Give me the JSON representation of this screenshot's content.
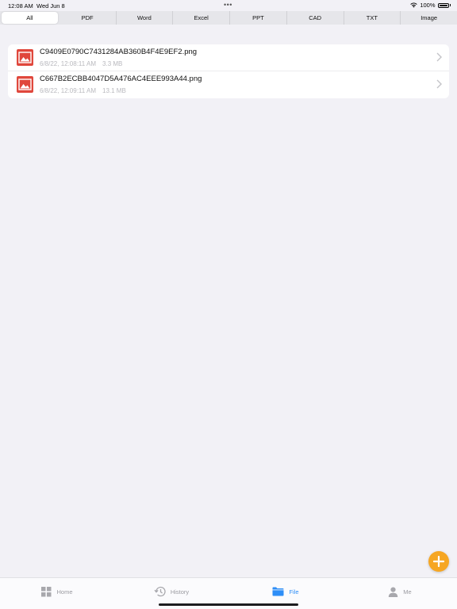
{
  "status": {
    "time": "12:08 AM",
    "date": "Wed Jun 8",
    "battery": "100%"
  },
  "tabs": [
    {
      "label": "All"
    },
    {
      "label": "PDF"
    },
    {
      "label": "Word"
    },
    {
      "label": "Excel"
    },
    {
      "label": "PPT"
    },
    {
      "label": "CAD"
    },
    {
      "label": "TXT"
    },
    {
      "label": "Image"
    }
  ],
  "files": [
    {
      "name": "C9409E0790C7431284AB360B4F4E9EF2.png",
      "date": "6/8/22, 12:08:11 AM",
      "size": "3.3 MB"
    },
    {
      "name": "C667B2ECBB4047D5A476AC4EEE993A44.png",
      "date": "6/8/22, 12:09:11 AM",
      "size": "13.1 MB"
    }
  ],
  "tab_bar": {
    "home": "Home",
    "history": "History",
    "file": "File",
    "me": "Me"
  },
  "colors": {
    "accent": "#2e8ef7",
    "fab": "#f6a623",
    "file_icon": "#e0473c"
  },
  "icons": {
    "fab": "plus-icon",
    "file": "image-file-icon",
    "row_action": "chevron-right-icon"
  }
}
